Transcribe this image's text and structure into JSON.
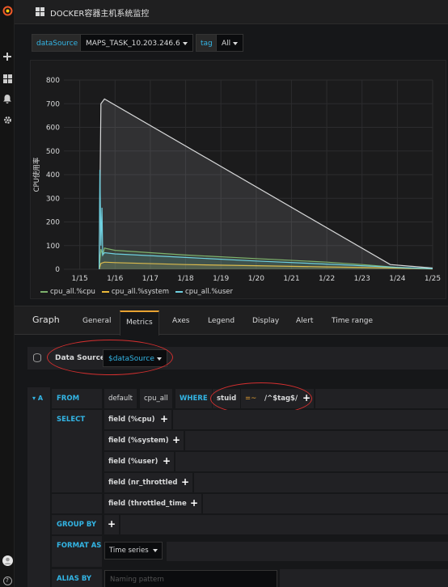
{
  "dashboard": {
    "title": "DOCKER容器主机系统监控"
  },
  "sidebar": {
    "icons": [
      "grafana-logo-icon",
      "plus-icon",
      "dashboards-icon",
      "bell-icon",
      "gear-icon",
      "avatar",
      "help-icon"
    ],
    "help_glyph": "?"
  },
  "templating": {
    "datasource_label": "dataSource",
    "datasource_value": "MAPS_TASK_10.203.246.6",
    "tag_label": "tag",
    "tag_value": "All"
  },
  "chart_data": {
    "type": "line",
    "ylabel": "CPU使用率",
    "ylim": [
      0,
      800
    ],
    "y_ticks": [
      "0",
      "100",
      "200",
      "300",
      "400",
      "500",
      "600",
      "700",
      "800"
    ],
    "x_ticks": [
      "1/15",
      "1/16",
      "1/17",
      "1/18",
      "1/19",
      "1/20",
      "1/21",
      "1/22",
      "1/23",
      "1/24",
      "1/25"
    ],
    "grid": true,
    "legend_position": "bottom-left",
    "series": [
      {
        "name": "cpu_all.%cpu",
        "color": "#7eb26d",
        "x": [
          15.55,
          15.6,
          15.65,
          15.7,
          15.75,
          16.0,
          18.0,
          20.0,
          22.0,
          23.0,
          24.0,
          25.0
        ],
        "y": [
          0,
          85,
          60,
          90,
          88,
          80,
          60,
          45,
          30,
          20,
          8,
          2
        ]
      },
      {
        "name": "cpu_all.%system",
        "color": "#eab839",
        "x": [
          15.55,
          15.6,
          15.7,
          16.0,
          18.0,
          20.0,
          22.0,
          24.0,
          25.0
        ],
        "y": [
          0,
          25,
          30,
          28,
          20,
          15,
          10,
          5,
          1
        ]
      },
      {
        "name": "cpu_all.%user",
        "color": "#6ed0e0",
        "x": [
          15.55,
          15.57,
          15.6,
          15.63,
          15.65,
          15.7,
          16.0,
          18.0,
          20.0,
          22.0,
          24.0,
          25.0
        ],
        "y": [
          0,
          420,
          100,
          260,
          60,
          70,
          65,
          50,
          35,
          22,
          8,
          2
        ]
      },
      {
        "name": "",
        "color": "#d8d9da",
        "x": [
          15.55,
          15.6,
          15.7,
          23.8,
          25.0
        ],
        "y": [
          0,
          700,
          720,
          20,
          5
        ]
      }
    ]
  },
  "tabs": {
    "title": "Graph",
    "items": [
      "General",
      "Metrics",
      "Axes",
      "Legend",
      "Display",
      "Alert",
      "Time range"
    ],
    "active": "Metrics"
  },
  "datasource_row": {
    "label": "Data Source",
    "value": "$dataSource"
  },
  "query": {
    "ref_id": "A",
    "from_keyword": "FROM",
    "policy": "default",
    "measurement": "cpu_all",
    "where_keyword": "WHERE",
    "where_key": "stuid",
    "where_op": "=~",
    "where_value": "/^$tag$/",
    "select_keyword": "SELECT",
    "fields": [
      "field (%cpu)",
      "field (%system)",
      "field (%user)",
      "field (nr_throttled)",
      "field (throttled_time)"
    ],
    "group_by_keyword": "GROUP BY",
    "format_as_keyword": "FORMAT AS",
    "format_as_value": "Time series",
    "alias_by_keyword": "ALIAS BY",
    "alias_placeholder": "Naming pattern"
  },
  "plus_glyph": "+"
}
